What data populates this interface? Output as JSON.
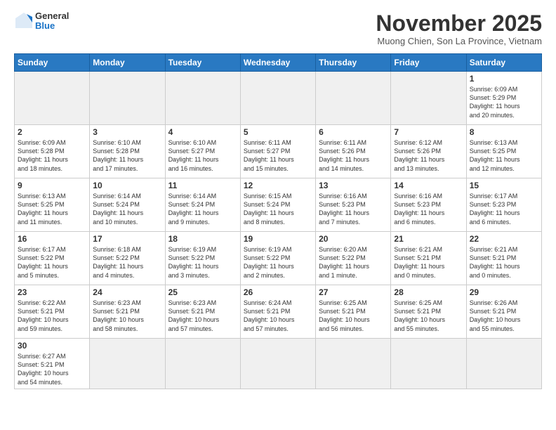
{
  "logo": {
    "general": "General",
    "blue": "Blue"
  },
  "header": {
    "month": "November 2025",
    "location": "Muong Chien, Son La Province, Vietnam"
  },
  "weekdays": [
    "Sunday",
    "Monday",
    "Tuesday",
    "Wednesday",
    "Thursday",
    "Friday",
    "Saturday"
  ],
  "weeks": [
    [
      {
        "day": "",
        "info": ""
      },
      {
        "day": "",
        "info": ""
      },
      {
        "day": "",
        "info": ""
      },
      {
        "day": "",
        "info": ""
      },
      {
        "day": "",
        "info": ""
      },
      {
        "day": "",
        "info": ""
      },
      {
        "day": "1",
        "info": "Sunrise: 6:09 AM\nSunset: 5:29 PM\nDaylight: 11 hours\nand 20 minutes."
      }
    ],
    [
      {
        "day": "2",
        "info": "Sunrise: 6:09 AM\nSunset: 5:28 PM\nDaylight: 11 hours\nand 18 minutes."
      },
      {
        "day": "3",
        "info": "Sunrise: 6:10 AM\nSunset: 5:28 PM\nDaylight: 11 hours\nand 17 minutes."
      },
      {
        "day": "4",
        "info": "Sunrise: 6:10 AM\nSunset: 5:27 PM\nDaylight: 11 hours\nand 16 minutes."
      },
      {
        "day": "5",
        "info": "Sunrise: 6:11 AM\nSunset: 5:27 PM\nDaylight: 11 hours\nand 15 minutes."
      },
      {
        "day": "6",
        "info": "Sunrise: 6:11 AM\nSunset: 5:26 PM\nDaylight: 11 hours\nand 14 minutes."
      },
      {
        "day": "7",
        "info": "Sunrise: 6:12 AM\nSunset: 5:26 PM\nDaylight: 11 hours\nand 13 minutes."
      },
      {
        "day": "8",
        "info": "Sunrise: 6:13 AM\nSunset: 5:25 PM\nDaylight: 11 hours\nand 12 minutes."
      }
    ],
    [
      {
        "day": "9",
        "info": "Sunrise: 6:13 AM\nSunset: 5:25 PM\nDaylight: 11 hours\nand 11 minutes."
      },
      {
        "day": "10",
        "info": "Sunrise: 6:14 AM\nSunset: 5:24 PM\nDaylight: 11 hours\nand 10 minutes."
      },
      {
        "day": "11",
        "info": "Sunrise: 6:14 AM\nSunset: 5:24 PM\nDaylight: 11 hours\nand 9 minutes."
      },
      {
        "day": "12",
        "info": "Sunrise: 6:15 AM\nSunset: 5:24 PM\nDaylight: 11 hours\nand 8 minutes."
      },
      {
        "day": "13",
        "info": "Sunrise: 6:16 AM\nSunset: 5:23 PM\nDaylight: 11 hours\nand 7 minutes."
      },
      {
        "day": "14",
        "info": "Sunrise: 6:16 AM\nSunset: 5:23 PM\nDaylight: 11 hours\nand 6 minutes."
      },
      {
        "day": "15",
        "info": "Sunrise: 6:17 AM\nSunset: 5:23 PM\nDaylight: 11 hours\nand 6 minutes."
      }
    ],
    [
      {
        "day": "16",
        "info": "Sunrise: 6:17 AM\nSunset: 5:22 PM\nDaylight: 11 hours\nand 5 minutes."
      },
      {
        "day": "17",
        "info": "Sunrise: 6:18 AM\nSunset: 5:22 PM\nDaylight: 11 hours\nand 4 minutes."
      },
      {
        "day": "18",
        "info": "Sunrise: 6:19 AM\nSunset: 5:22 PM\nDaylight: 11 hours\nand 3 minutes."
      },
      {
        "day": "19",
        "info": "Sunrise: 6:19 AM\nSunset: 5:22 PM\nDaylight: 11 hours\nand 2 minutes."
      },
      {
        "day": "20",
        "info": "Sunrise: 6:20 AM\nSunset: 5:22 PM\nDaylight: 11 hours\nand 1 minute."
      },
      {
        "day": "21",
        "info": "Sunrise: 6:21 AM\nSunset: 5:21 PM\nDaylight: 11 hours\nand 0 minutes."
      },
      {
        "day": "22",
        "info": "Sunrise: 6:21 AM\nSunset: 5:21 PM\nDaylight: 11 hours\nand 0 minutes."
      }
    ],
    [
      {
        "day": "23",
        "info": "Sunrise: 6:22 AM\nSunset: 5:21 PM\nDaylight: 10 hours\nand 59 minutes."
      },
      {
        "day": "24",
        "info": "Sunrise: 6:23 AM\nSunset: 5:21 PM\nDaylight: 10 hours\nand 58 minutes."
      },
      {
        "day": "25",
        "info": "Sunrise: 6:23 AM\nSunset: 5:21 PM\nDaylight: 10 hours\nand 57 minutes."
      },
      {
        "day": "26",
        "info": "Sunrise: 6:24 AM\nSunset: 5:21 PM\nDaylight: 10 hours\nand 57 minutes."
      },
      {
        "day": "27",
        "info": "Sunrise: 6:25 AM\nSunset: 5:21 PM\nDaylight: 10 hours\nand 56 minutes."
      },
      {
        "day": "28",
        "info": "Sunrise: 6:25 AM\nSunset: 5:21 PM\nDaylight: 10 hours\nand 55 minutes."
      },
      {
        "day": "29",
        "info": "Sunrise: 6:26 AM\nSunset: 5:21 PM\nDaylight: 10 hours\nand 55 minutes."
      }
    ],
    [
      {
        "day": "30",
        "info": "Sunrise: 6:27 AM\nSunset: 5:21 PM\nDaylight: 10 hours\nand 54 minutes."
      },
      {
        "day": "",
        "info": ""
      },
      {
        "day": "",
        "info": ""
      },
      {
        "day": "",
        "info": ""
      },
      {
        "day": "",
        "info": ""
      },
      {
        "day": "",
        "info": ""
      },
      {
        "day": "",
        "info": ""
      }
    ]
  ]
}
